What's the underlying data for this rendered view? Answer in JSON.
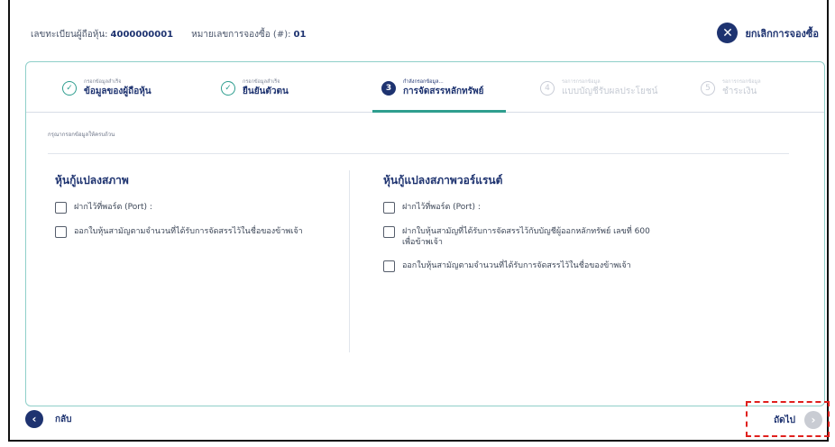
{
  "header": {
    "register_label": "เลขทะเบียนผู้ถือหุ้น:",
    "register_value": "4000000001",
    "booking_label": "หมายเลขการจองซื้อ (#):",
    "booking_value": "01",
    "cancel_label": "ยกเลิกการจองซื้อ"
  },
  "steps": [
    {
      "sub": "กรอกข้อมูลสำเร็จ",
      "main": "ข้อมูลของผู้ถือหุ้น",
      "state": "done",
      "icon": "✓"
    },
    {
      "sub": "กรอกข้อมูลสำเร็จ",
      "main": "ยืนยันตัวตน",
      "state": "done",
      "icon": "✓"
    },
    {
      "sub": "กำลังกรอกข้อมูล...",
      "main": "การจัดสรรหลักทรัพย์",
      "state": "active",
      "icon": "3"
    },
    {
      "sub": "รอการกรอกข้อมูล",
      "main": "แบบบัญชีรับผลประโยชน์",
      "state": "pending",
      "icon": "4"
    },
    {
      "sub": "รอการกรอกข้อมูล",
      "main": "ชำระเงิน",
      "state": "pending",
      "icon": "5"
    }
  ],
  "hint": "กรุณากรอกข้อมูลให้ครบถ้วน",
  "left_section": {
    "title": "หุ้นกู้แปลงสภาพ",
    "options": [
      "ฝากไว้ที่พอร์ต (Port) :",
      "ออกใบหุ้นสามัญตามจำนวนที่ได้รับการจัดสรรไว้ในชื่อของข้าพเจ้า"
    ]
  },
  "right_section": {
    "title": "หุ้นกู้แปลงสภาพวอร์แรนต์",
    "options": [
      "ฝากไว้ที่พอร์ต (Port) :",
      "ฝากใบหุ้นสามัญที่ได้รับการจัดสรรไว้กับบัญชีผู้ออกหลักทรัพย์ เลขที่ 600 เพื่อข้าพเจ้า",
      "ออกใบหุ้นสามัญตามจำนวนที่ได้รับการจัดสรรไว้ในชื่อของข้าพเจ้า"
    ]
  },
  "footer": {
    "back_label": "กลับ",
    "next_label": "ถัดไป"
  }
}
